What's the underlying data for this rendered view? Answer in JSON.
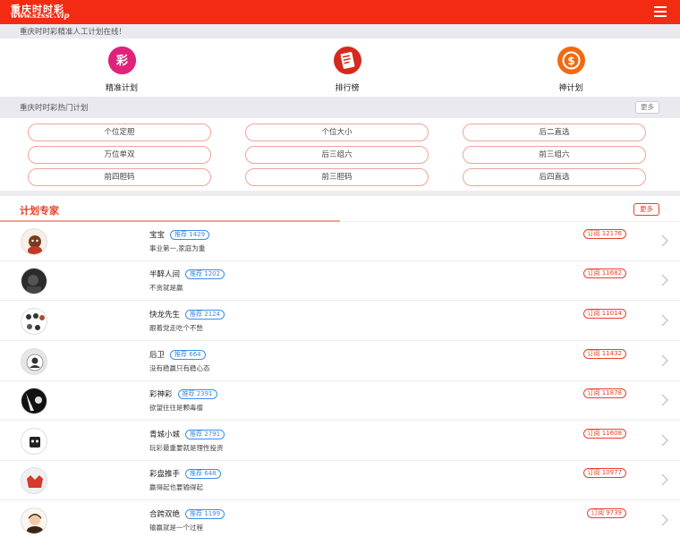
{
  "header": {
    "logo_main": "重庆时时彩",
    "logo_sub": "www.szssc.vip",
    "bg_color": "#f22b12"
  },
  "notice": {
    "text": "重庆时时彩精准人工计划在线！"
  },
  "nav": [
    {
      "label": "精准计划",
      "icon": "cai-icon",
      "color": "#e0237a",
      "glyph": "彩"
    },
    {
      "label": "排行榜",
      "icon": "ranking-icon",
      "color": "#d42a1e",
      "glyph": ""
    },
    {
      "label": "神计划",
      "icon": "coin-icon",
      "color": "#f06a12",
      "glyph": "$"
    }
  ],
  "hot_plans": {
    "title": "重庆时时彩热门计划",
    "more_label": "更多",
    "items": [
      "个位定胆",
      "个位大小",
      "后二直选",
      "万位单双",
      "后三组六",
      "前三组六",
      "前四胆码",
      "前三胆码",
      "后四直选"
    ]
  },
  "experts": {
    "title": "计划专家",
    "more_label": "更多",
    "accent_color": "#e8402a",
    "list": [
      {
        "name": "宝宝",
        "recommend": "推荐 1429",
        "motto": "事业第一,家庭为重",
        "subscribe": "订阅 12176"
      },
      {
        "name": "半醉人间",
        "recommend": "推荐 1202",
        "motto": "不贪就是赢",
        "subscribe": "订阅 11682"
      },
      {
        "name": "快龙先生",
        "recommend": "推荐 2124",
        "motto": "跟着党走吃个不愁",
        "subscribe": "订阅 11014"
      },
      {
        "name": "后卫",
        "recommend": "推荐 664",
        "motto": "没有稳赢只有稳心态",
        "subscribe": "订阅 11432"
      },
      {
        "name": "彩神彩",
        "recommend": "推荐 2391",
        "motto": "欲望往往是颗毒瘤",
        "subscribe": "订阅 11878"
      },
      {
        "name": "青城小城",
        "recommend": "推荐 2791",
        "motto": "玩彩最重要就是理性投资",
        "subscribe": "订阅 11608"
      },
      {
        "name": "彩盘推手",
        "recommend": "推荐 648",
        "motto": "赢得起也要输得起",
        "subscribe": "订阅 10977"
      },
      {
        "name": "合跨双绝",
        "recommend": "推荐 1199",
        "motto": "输赢就是一个过程",
        "subscribe": "订阅 9739"
      }
    ]
  }
}
